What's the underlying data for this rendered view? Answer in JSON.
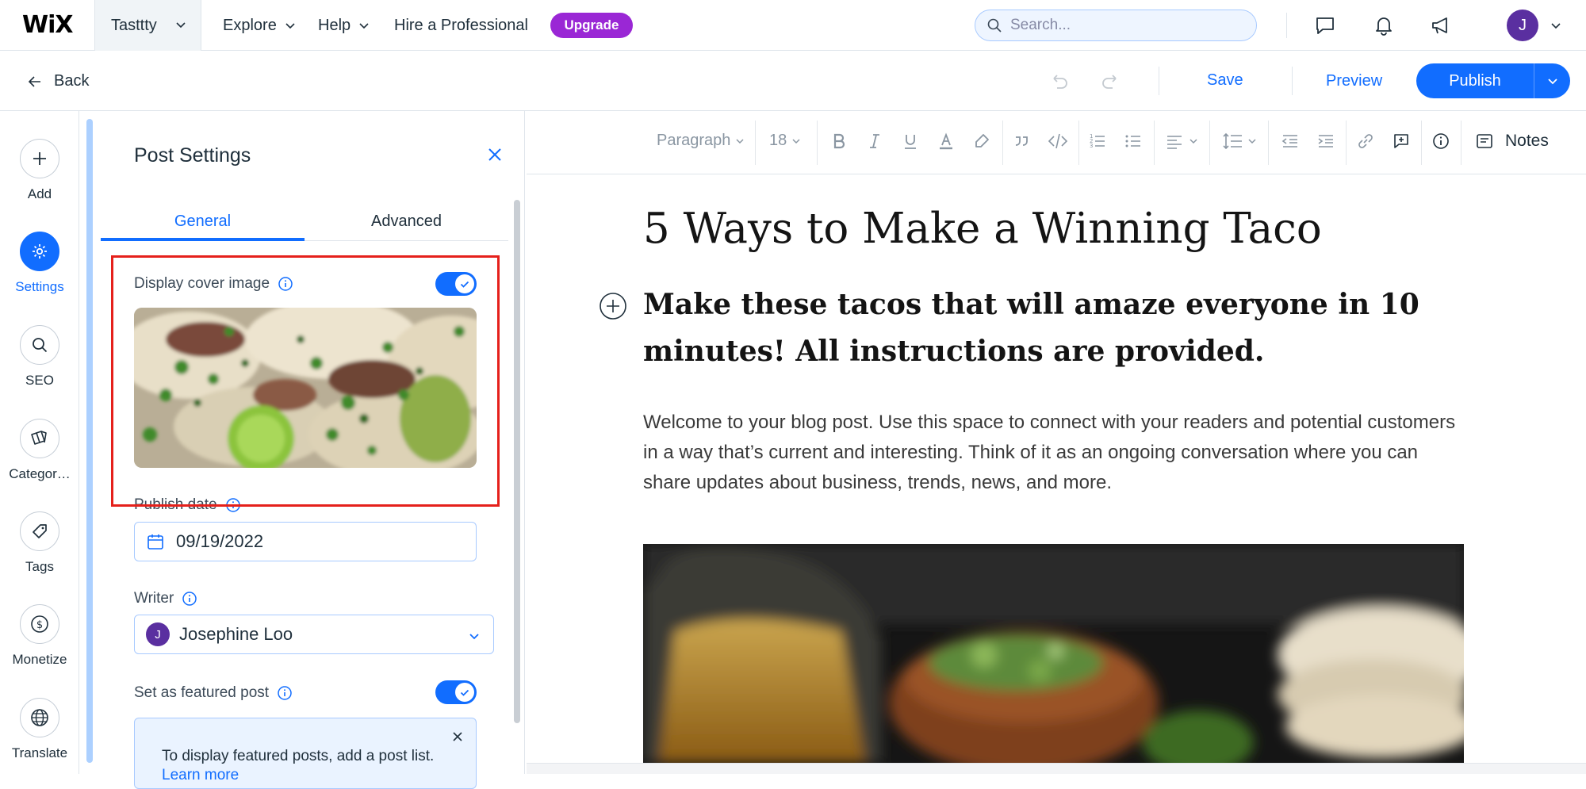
{
  "topbar": {
    "logo": "WiX",
    "site_name": "Tasttty",
    "nav": [
      {
        "label": "Explore"
      },
      {
        "label": "Help"
      },
      {
        "label": "Hire a Professional"
      }
    ],
    "upgrade_label": "Upgrade",
    "search_placeholder": "Search...",
    "avatar_initial": "J"
  },
  "actionbar": {
    "back_label": "Back",
    "save_label": "Save",
    "preview_label": "Preview",
    "publish_label": "Publish"
  },
  "rail": {
    "items": [
      {
        "label": "Add",
        "icon": "plus-icon"
      },
      {
        "label": "Settings",
        "icon": "gear-icon",
        "active": true
      },
      {
        "label": "SEO",
        "icon": "search-icon"
      },
      {
        "label": "Categor…",
        "icon": "categories-icon"
      },
      {
        "label": "Tags",
        "icon": "tag-icon"
      },
      {
        "label": "Monetize",
        "icon": "dollar-icon"
      },
      {
        "label": "Translate",
        "icon": "globe-icon"
      }
    ]
  },
  "panel": {
    "title": "Post Settings",
    "tabs": [
      "General",
      "Advanced"
    ],
    "active_tab": "General",
    "display_cover_label": "Display cover image",
    "display_cover_on": true,
    "publish_date_label": "Publish date",
    "publish_date_value": "09/19/2022",
    "writer_label": "Writer",
    "writer_initial": "J",
    "writer_name": "Josephine Loo",
    "featured_label": "Set as featured post",
    "featured_on": true,
    "notice_text": "To display featured posts, add a post list.",
    "notice_link": "Learn more"
  },
  "toolbar": {
    "paragraph_label": "Paragraph",
    "font_size": "18",
    "notes_label": "Notes"
  },
  "post": {
    "title": "5 Ways to Make a Winning Taco",
    "subtitle": "Make these tacos that will amaze everyone in 10 minutes! All instructions are provided.",
    "body": "Welcome to your blog post. Use this space to connect with your readers and potential customers in a way that’s current and interesting. Think of it as an ongoing conversation where you can share updates about business, trends, news, and more."
  },
  "colors": {
    "accent": "#116dff",
    "upgrade": "#9a27d5",
    "avatar": "#5a2fa0",
    "highlight": "#e5201b"
  }
}
